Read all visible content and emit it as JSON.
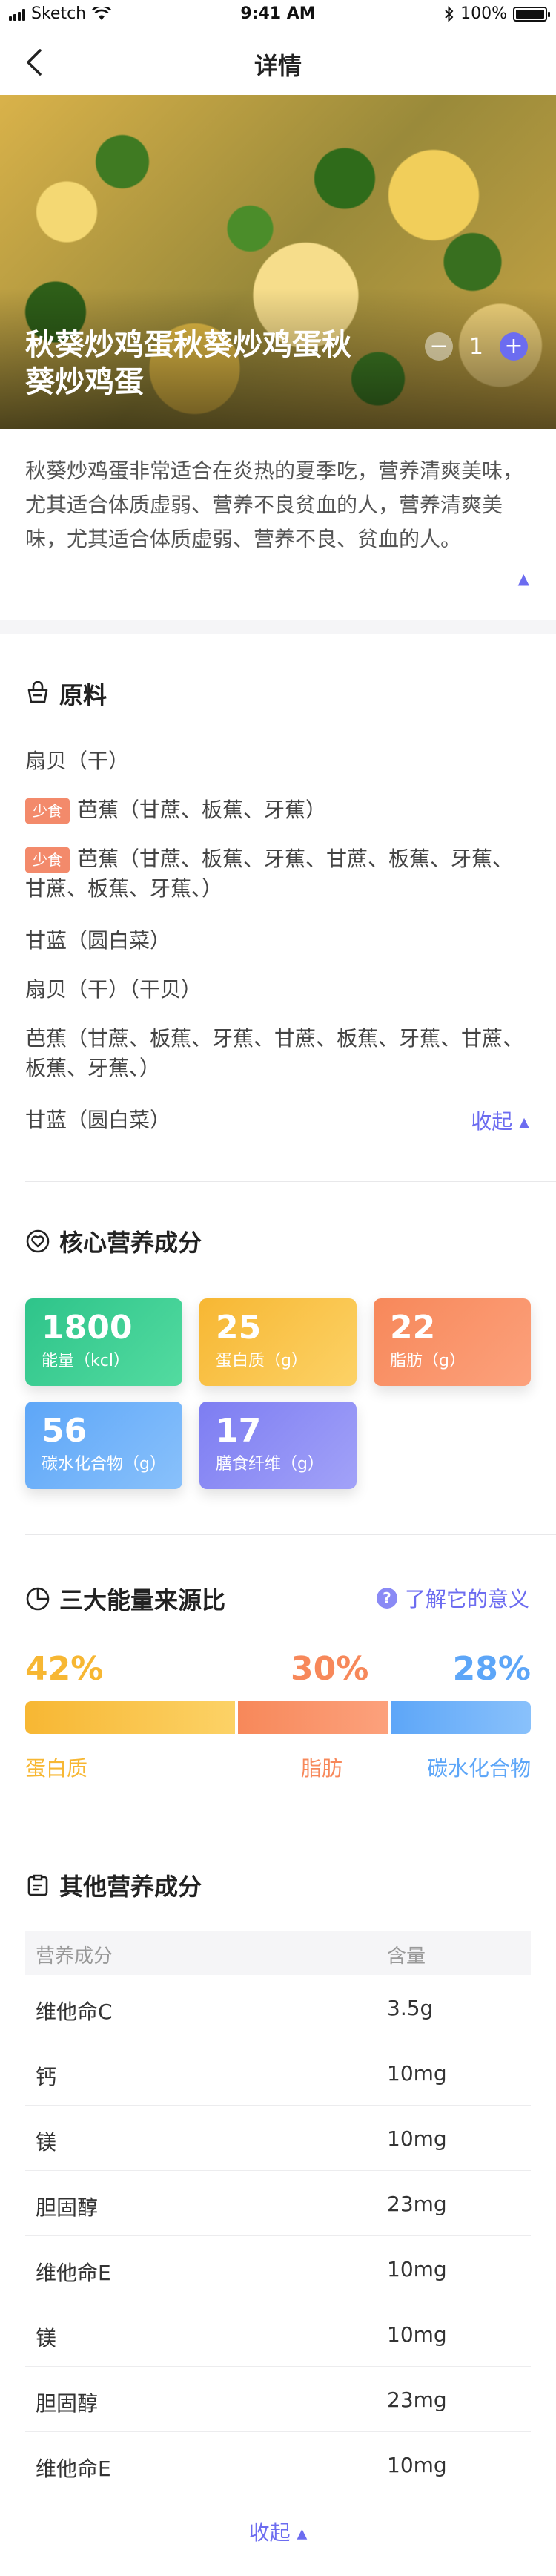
{
  "status": {
    "carrier": "Sketch",
    "time": "9:41 AM",
    "battery": "100%"
  },
  "nav": {
    "title": "详情"
  },
  "hero": {
    "dish": "秋葵炒鸡蛋秋葵炒鸡蛋秋葵炒鸡蛋",
    "qty": "1"
  },
  "desc": {
    "text": "秋葵炒鸡蛋非常适合在炎热的夏季吃，营养清爽美味，尤其适合体质虚弱、营养不良贫血的人，营养清爽美味，尤其适合体质虚弱、营养不良、贫血的人。"
  },
  "ingredients": {
    "title": "原料",
    "items": [
      {
        "tag": "",
        "text": "扇贝（干）"
      },
      {
        "tag": "少食",
        "text": "芭蕉（甘蔗、板蕉、牙蕉）"
      },
      {
        "tag": "少食",
        "text": "芭蕉（甘蔗、板蕉、牙蕉、甘蔗、板蕉、牙蕉、甘蔗、板蕉、牙蕉、）"
      },
      {
        "tag": "",
        "text": "甘蓝（圆白菜）"
      },
      {
        "tag": "",
        "text": "扇贝（干）（干贝）"
      },
      {
        "tag": "",
        "text": "芭蕉（甘蔗、板蕉、牙蕉、甘蔗、板蕉、牙蕉、甘蔗、板蕉、牙蕉、）"
      },
      {
        "tag": "",
        "text": "甘蓝（圆白菜）"
      }
    ],
    "collapse": "收起"
  },
  "core": {
    "title": "核心营养成分",
    "cards": [
      {
        "value": "1800",
        "label": "能量（kcl）"
      },
      {
        "value": "25",
        "label": "蛋白质（g）"
      },
      {
        "value": "22",
        "label": "脂肪（g）"
      },
      {
        "value": "56",
        "label": "碳水化合物（g）"
      },
      {
        "value": "17",
        "label": "膳食纤维（g）"
      }
    ]
  },
  "energy": {
    "title": "三大能量来源比",
    "learn": "了解它的意义",
    "parts": [
      {
        "pct": "42%",
        "value": 42,
        "label": "蛋白质",
        "color": "#f7b733"
      },
      {
        "pct": "30%",
        "value": 30,
        "label": "脂肪",
        "color": "#f7885a"
      },
      {
        "pct": "28%",
        "value": 28,
        "label": "碳水化合物",
        "color": "#5da6f8"
      }
    ]
  },
  "other": {
    "title": "其他营养成分",
    "headers": [
      "营养成分",
      "含量"
    ],
    "rows": [
      [
        "维他命C",
        "3.5g"
      ],
      [
        "钙",
        "10mg"
      ],
      [
        "镁",
        "10mg"
      ],
      [
        "胆固醇",
        "23mg"
      ],
      [
        "维他命E",
        "10mg"
      ],
      [
        "镁",
        "10mg"
      ],
      [
        "胆固醇",
        "23mg"
      ],
      [
        "维他命E",
        "10mg"
      ]
    ],
    "collapse": "收起"
  },
  "colors": {
    "accent": "#6c6cf0",
    "tag": "#f38a6b"
  }
}
